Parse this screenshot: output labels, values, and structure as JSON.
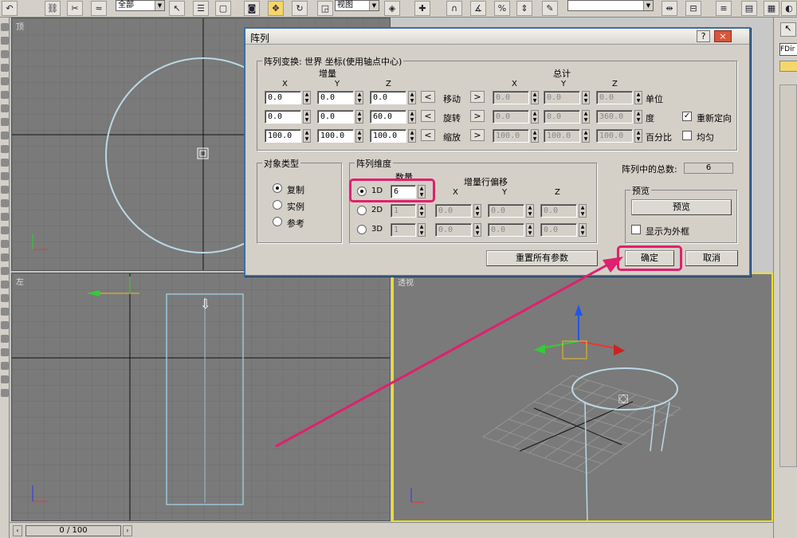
{
  "toolbar": {
    "selection_filter": "全部",
    "ref_coord": "视图"
  },
  "viewports": {
    "top": "顶",
    "left": "左",
    "perspective": "透视"
  },
  "right_panel": {
    "object_name": "FDir"
  },
  "timeline": {
    "frame": "0 / 100"
  },
  "dialog": {
    "title": "阵列",
    "help": "?",
    "close": "×",
    "transform_group": "阵列变换: 世界 坐标(使用轴点中心)",
    "increment_header": "增量",
    "totals_header": "总计",
    "axes": [
      "X",
      "Y",
      "Z"
    ],
    "rows": [
      {
        "label": "移动",
        "unit": "单位",
        "inc": [
          "0.0",
          "0.0",
          "0.0"
        ],
        "tot": [
          "0.0",
          "0.0",
          "0.0"
        ]
      },
      {
        "label": "旋转",
        "unit": "度",
        "inc": [
          "0.0",
          "0.0",
          "60.0"
        ],
        "tot": [
          "0.0",
          "0.0",
          "360.0"
        ]
      },
      {
        "label": "缩放",
        "unit": "百分比",
        "inc": [
          "100.0",
          "100.0",
          "100.0"
        ],
        "tot": [
          "100.0",
          "100.0",
          "100.0"
        ]
      }
    ],
    "reorient_label": "重新定向",
    "reorient_checked": true,
    "uniform_label": "均匀",
    "uniform_checked": false,
    "object_type_group": "对象类型",
    "object_types": [
      "复制",
      "实例",
      "参考"
    ],
    "object_type_selected": 0,
    "dimensions_group": "阵列维度",
    "count_header": "数量",
    "row_offset_header": "增量行偏移",
    "dims": [
      {
        "label": "1D",
        "count": "6",
        "x": "",
        "y": "",
        "z": ""
      },
      {
        "label": "2D",
        "count": "1",
        "x": "0.0",
        "y": "0.0",
        "z": "0.0"
      },
      {
        "label": "3D",
        "count": "1",
        "x": "0.0",
        "y": "0.0",
        "z": "0.0"
      }
    ],
    "dim_selected": 0,
    "total_label": "阵列中的总数:",
    "total_value": "6",
    "preview_group": "预览",
    "preview_button": "预览",
    "show_box_label": "显示为外框",
    "reset_button": "重置所有参数",
    "ok_button": "确定",
    "cancel_button": "取消"
  },
  "colors": {
    "highlight": "#e0206e",
    "viewport_bg": "#7a7a7a",
    "active_viewport_border": "#f0e020"
  }
}
